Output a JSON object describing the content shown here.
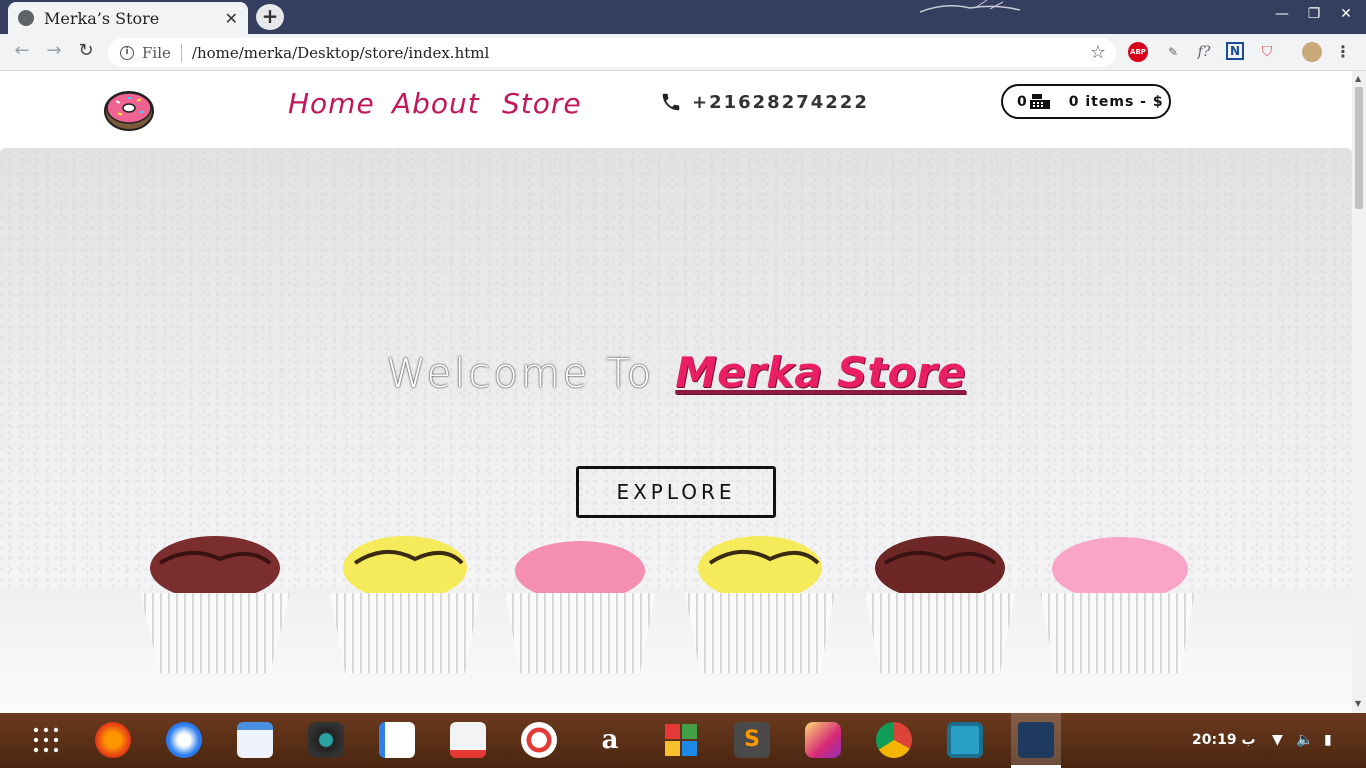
{
  "browser": {
    "tab_title": "Merka’s  Store",
    "tab_close": "✕",
    "new_tab": "+",
    "window_controls": [
      "—",
      "❐",
      "✕"
    ],
    "address": {
      "scheme_label": "File",
      "url": "/home/merka/Desktop/store/index.html",
      "info": "i",
      "star": "☆"
    },
    "nav": {
      "back": "←",
      "forward": "→",
      "reload": "↻"
    },
    "extensions": {
      "abp": "ABP",
      "pen": "✎",
      "f": "f?",
      "n": "N",
      "shield": "⛉",
      "menu": "⋮"
    }
  },
  "site": {
    "nav": {
      "home": "Home",
      "about": "About",
      "store": "Store"
    },
    "phone": "+21628274222",
    "cart": {
      "count": "0",
      "items": "0 items - $"
    },
    "hero": {
      "welcome": "Welcome To",
      "brand": "Merka Store",
      "explore": "EXPLORE"
    }
  },
  "taskbar": {
    "apps": [
      "apps-grid",
      "firefox",
      "thunderbird",
      "files",
      "media",
      "docs",
      "store",
      "help",
      "amazon",
      "tiles",
      "sublime",
      "camera",
      "chrome",
      "remote",
      "vscode"
    ],
    "amazon_glyph": "a",
    "sublime_glyph": "S",
    "clock": "20:19 ب",
    "tray": {
      "wifi": "▼",
      "volume": "🔈",
      "battery": "▮"
    }
  },
  "colors": {
    "accent": "#e91e63",
    "tabbar": "#343f5f",
    "nav_link": "#c2185b"
  }
}
